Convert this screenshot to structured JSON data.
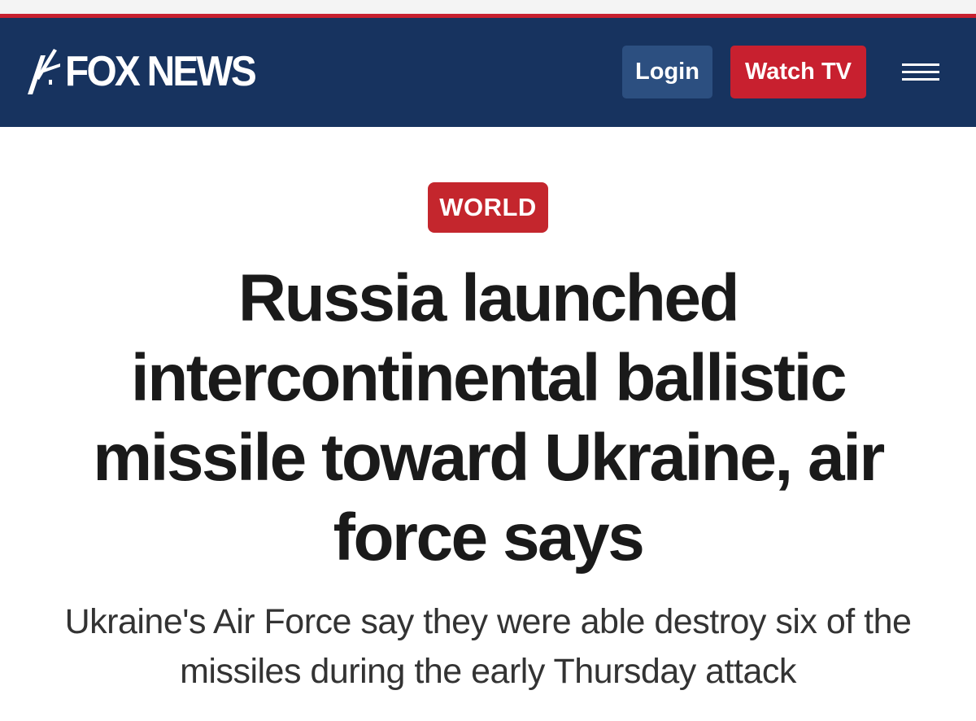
{
  "header": {
    "logo_text": "FOX NEWS",
    "login_label": "Login",
    "watch_tv_label": "Watch TV",
    "menu_icon": "hamburger-menu-icon"
  },
  "article": {
    "category": "WORLD",
    "headline": "Russia launched intercontinental ballistic missile toward Ukraine, air force says",
    "subheadline": "Ukraine's Air Force say they were able destroy six of the missiles during the early Thursday attack"
  },
  "colors": {
    "header_bg": "#17335f",
    "accent_red": "#c8202f",
    "login_bg": "#2c4f80",
    "headline_text": "#1a1a1a"
  }
}
